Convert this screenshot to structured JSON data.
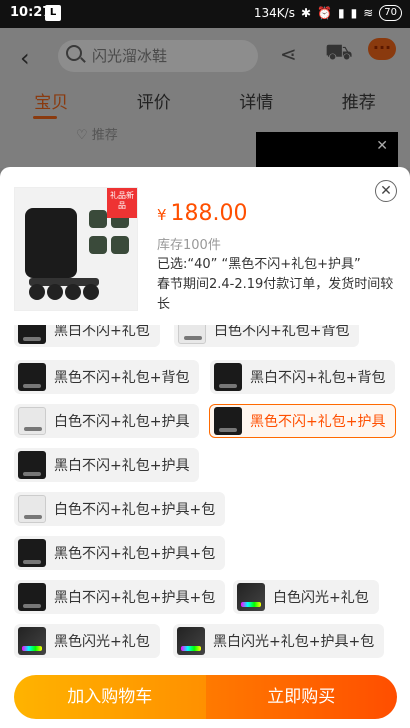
{
  "status_bar": {
    "time": "10:27",
    "app_badge": "L",
    "network_speed": "134K/s",
    "battery": "70"
  },
  "header": {
    "search_placeholder": "闪光溜冰鞋",
    "tabs": [
      {
        "label": "宝贝"
      },
      {
        "label": "评价"
      },
      {
        "label": "详情"
      },
      {
        "label": "推荐"
      }
    ],
    "fav_label": "推荐"
  },
  "sheet": {
    "promo_tag": "礼品新品",
    "price_symbol": "¥",
    "price": "188.00",
    "stock": "库存100件",
    "selected": "已选:“40” “黑色不闪+礼包+护具”",
    "shipping_note": "春节期间2.4-2.19付款订单，发货时间较长",
    "options": [
      {
        "label": "黑白不闪+礼包",
        "thumb": "black"
      },
      {
        "label": "白色不闪+礼包+背包",
        "thumb": "white"
      },
      {
        "label": "黑色不闪+礼包+背包",
        "thumb": "black"
      },
      {
        "label": "黑白不闪+礼包+背包",
        "thumb": "black"
      },
      {
        "label": "白色不闪+礼包+护具",
        "thumb": "white"
      },
      {
        "label": "黑色不闪+礼包+护具",
        "thumb": "black",
        "selected": true
      },
      {
        "label": "黑白不闪+礼包+护具",
        "thumb": "black"
      },
      {
        "label": "白色不闪+礼包+护具+包",
        "thumb": "white"
      },
      {
        "label": "黑色不闪+礼包+护具+包",
        "thumb": "black"
      },
      {
        "label": "黑白不闪+礼包+护具+包",
        "thumb": "black"
      },
      {
        "label": "白色闪光+礼包",
        "thumb": "flash"
      },
      {
        "label": "黑色闪光+礼包",
        "thumb": "flash"
      },
      {
        "label": "黑白闪光+礼包+护具+包",
        "thumb": "flash"
      }
    ],
    "add_to_cart": "加入购物车",
    "buy_now": "立即购买"
  }
}
